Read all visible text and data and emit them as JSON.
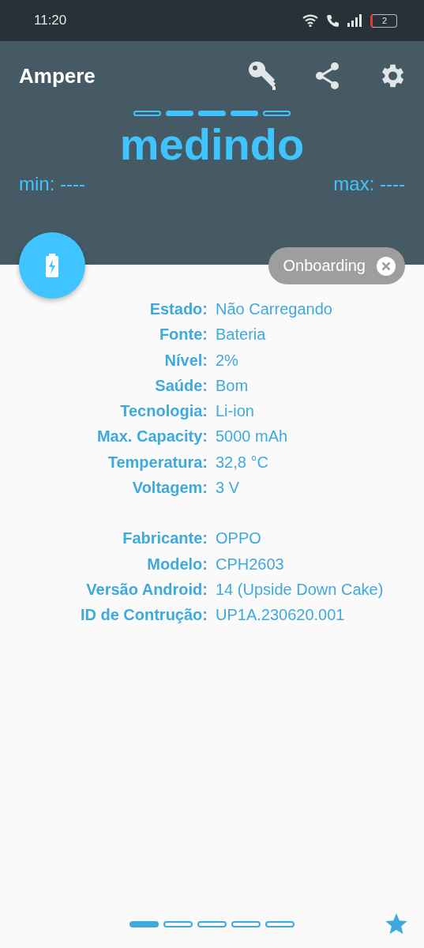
{
  "status_bar": {
    "time": "11:20",
    "battery_text": "2"
  },
  "app_bar": {
    "title": "Ampere"
  },
  "meter_segments": [
    {
      "filled": false
    },
    {
      "filled": true
    },
    {
      "filled": true
    },
    {
      "filled": true
    },
    {
      "filled": false
    }
  ],
  "reading": "medindo",
  "min": "min: ----",
  "max": "max: ----",
  "chip": {
    "label": "Onboarding"
  },
  "groups": [
    [
      {
        "label": "Estado:",
        "value": "Não Carregando"
      },
      {
        "label": "Fonte:",
        "value": "Bateria"
      },
      {
        "label": "Nível:",
        "value": "2%"
      },
      {
        "label": "Saúde:",
        "value": "Bom"
      },
      {
        "label": "Tecnologia:",
        "value": "Li-ion"
      },
      {
        "label": "Max. Capacity:",
        "value": "5000 mAh"
      },
      {
        "label": "Temperatura:",
        "value": "32,8 °C"
      },
      {
        "label": "Voltagem:",
        "value": "3 V"
      }
    ],
    [
      {
        "label": "Fabricante:",
        "value": "OPPO"
      },
      {
        "label": "Modelo:",
        "value": "CPH2603"
      },
      {
        "label": "Versão Android:",
        "value": "14 (Upside Down Cake)"
      },
      {
        "label": "ID de Contrução:",
        "value": "UP1A.230620.001"
      }
    ]
  ],
  "pages": [
    {
      "selected": true
    },
    {
      "selected": false
    },
    {
      "selected": false
    },
    {
      "selected": false
    },
    {
      "selected": false
    }
  ]
}
